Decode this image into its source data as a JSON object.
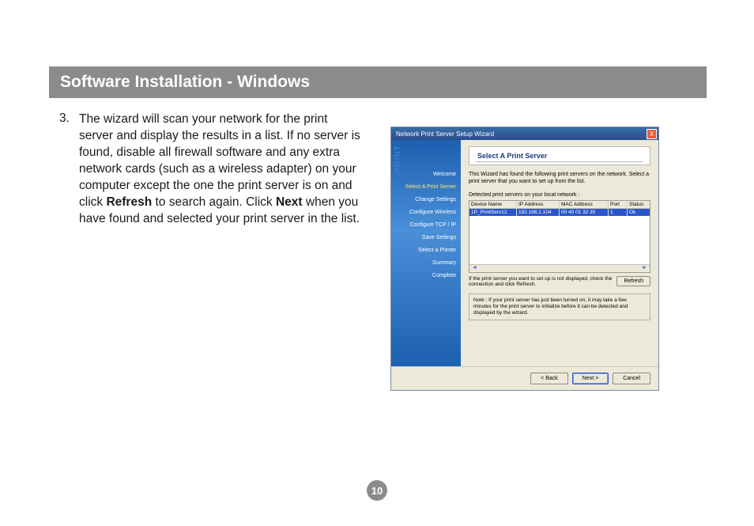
{
  "header": {
    "title": "Software Installation - Windows"
  },
  "step": {
    "number": "3.",
    "text_before_refresh": "The wizard will scan your network for the print server and display the results in a list.  If no server is found, disable all firewall software and any extra network cards (such as a wireless adapter) on your computer except the one the print server is on and click ",
    "refresh_word": "Refresh",
    "text_mid": " to search again.  Click ",
    "next_word": "Next",
    "text_after": " when you have found and selected your print server in the list."
  },
  "page_number": "10",
  "wizard": {
    "window_title": "Network Print Server Setup Wizard",
    "close_label": "X",
    "sidebar_brand": "PRINT",
    "nav": [
      {
        "label": "Welcome",
        "active": false
      },
      {
        "label": "Select A Print Server",
        "active": true
      },
      {
        "label": "Change Settings",
        "active": false
      },
      {
        "label": "Configure Wireless",
        "active": false
      },
      {
        "label": "Configure TCP / IP",
        "active": false
      },
      {
        "label": "Save Settings",
        "active": false
      },
      {
        "label": "Select a Printer",
        "active": false
      },
      {
        "label": "Summary",
        "active": false
      },
      {
        "label": "Complete",
        "active": false
      }
    ],
    "panel_title": "Select A Print Server",
    "instruction": "This Wizard has found the following print servers on the network. Select a print server that you want to set up from the list.",
    "detected_label": "Detected print servers on your local network :",
    "table": {
      "headers": [
        "Device Name",
        "IP Address",
        "MAC Address",
        "Port",
        "Status"
      ],
      "row": [
        "1P_PrintServ12",
        "192.168.1.104",
        "00 40 01 32 35",
        "1",
        "Ok"
      ]
    },
    "refresh_hint": "If the print server you want to set up is not displayed, check the connection and click Refresh.",
    "refresh_button": "Refresh",
    "note": "Note : If your print server has just been turned on, it may take a few minutes for the print server to initialize before it can be detected and displayed by the wizard.",
    "buttons": {
      "back": "< Back",
      "next": "Next >",
      "cancel": "Cancel"
    }
  }
}
